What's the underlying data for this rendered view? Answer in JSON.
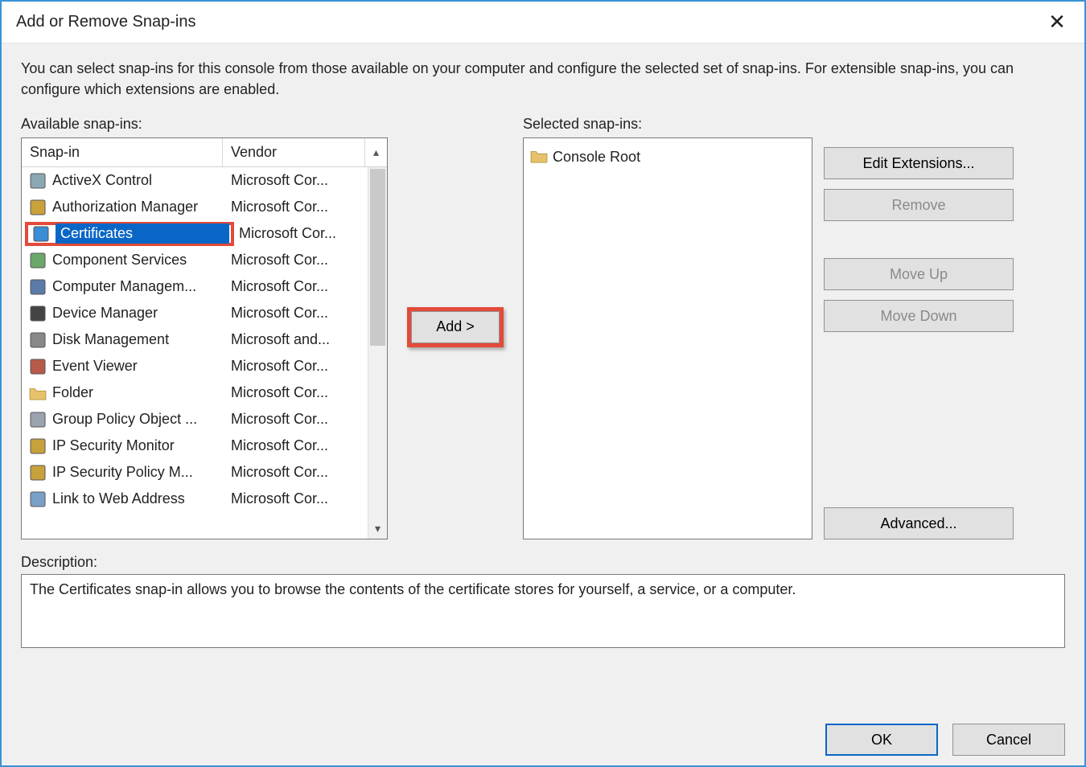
{
  "window": {
    "title": "Add or Remove Snap-ins"
  },
  "intro": "You can select snap-ins for this console from those available on your computer and configure the selected set of snap-ins. For extensible snap-ins, you can configure which extensions are enabled.",
  "labels": {
    "available": "Available snap-ins:",
    "selected": "Selected snap-ins:",
    "description": "Description:"
  },
  "columns": {
    "snapin": "Snap-in",
    "vendor": "Vendor"
  },
  "available_list": [
    {
      "name": "ActiveX Control",
      "vendor": "Microsoft Cor...",
      "icon": "activex-icon",
      "selected": false,
      "highlighted": false
    },
    {
      "name": "Authorization Manager",
      "vendor": "Microsoft Cor...",
      "icon": "auth-icon",
      "selected": false,
      "highlighted": false
    },
    {
      "name": "Certificates",
      "vendor": "Microsoft Cor...",
      "icon": "cert-icon",
      "selected": true,
      "highlighted": true
    },
    {
      "name": "Component Services",
      "vendor": "Microsoft Cor...",
      "icon": "component-icon",
      "selected": false,
      "highlighted": false
    },
    {
      "name": "Computer Managem...",
      "vendor": "Microsoft Cor...",
      "icon": "compmgmt-icon",
      "selected": false,
      "highlighted": false
    },
    {
      "name": "Device Manager",
      "vendor": "Microsoft Cor...",
      "icon": "device-icon",
      "selected": false,
      "highlighted": false
    },
    {
      "name": "Disk Management",
      "vendor": "Microsoft and...",
      "icon": "disk-icon",
      "selected": false,
      "highlighted": false
    },
    {
      "name": "Event Viewer",
      "vendor": "Microsoft Cor...",
      "icon": "event-icon",
      "selected": false,
      "highlighted": false
    },
    {
      "name": "Folder",
      "vendor": "Microsoft Cor...",
      "icon": "folder-icon",
      "selected": false,
      "highlighted": false
    },
    {
      "name": "Group Policy Object ...",
      "vendor": "Microsoft Cor...",
      "icon": "gpo-icon",
      "selected": false,
      "highlighted": false
    },
    {
      "name": "IP Security Monitor",
      "vendor": "Microsoft Cor...",
      "icon": "ipsecmon-icon",
      "selected": false,
      "highlighted": false
    },
    {
      "name": "IP Security Policy M...",
      "vendor": "Microsoft Cor...",
      "icon": "ipsecpol-icon",
      "selected": false,
      "highlighted": false
    },
    {
      "name": "Link to Web Address",
      "vendor": "Microsoft Cor...",
      "icon": "weblink-icon",
      "selected": false,
      "highlighted": false
    }
  ],
  "selected_tree": [
    {
      "name": "Console Root",
      "icon": "folder-icon"
    }
  ],
  "buttons": {
    "add": "Add >",
    "edit_ext": "Edit Extensions...",
    "remove": "Remove",
    "move_up": "Move Up",
    "move_down": "Move Down",
    "advanced": "Advanced...",
    "ok": "OK",
    "cancel": "Cancel"
  },
  "description_text": "The Certificates snap-in allows you to browse the contents of the certificate stores for yourself, a service, or a computer."
}
